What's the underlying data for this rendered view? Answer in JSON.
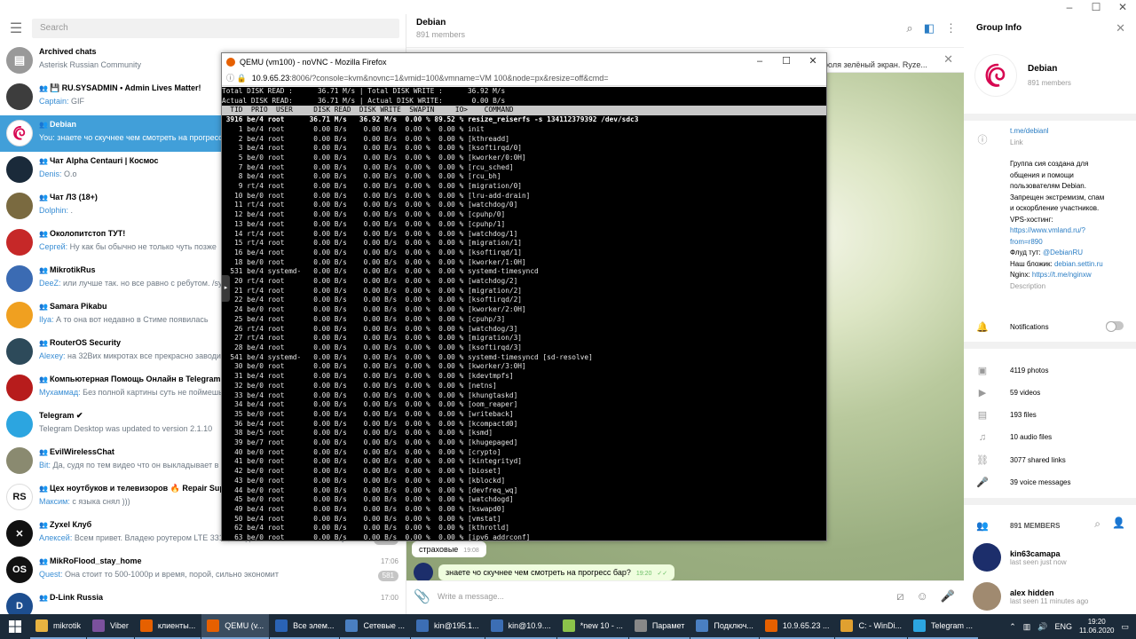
{
  "left": {
    "search_placeholder": "Search",
    "chats": [
      {
        "name": "Archived chats",
        "preview": "Asterisk Russian Community",
        "sender": "",
        "time": "",
        "badge": "",
        "color": "#999999",
        "initials": "",
        "group": false
      },
      {
        "name": "💾 RU.SYSADMIN • Admin Lives Matter!",
        "preview": "GIF",
        "sender": "Captain:",
        "time": "",
        "badge": "",
        "color": "#3d3d3d",
        "initials": "",
        "group": true
      },
      {
        "name": "Debian",
        "preview": "знаете чо скучнее чем смотреть на прогресс бар?",
        "sender": "You:",
        "time": "",
        "badge": "",
        "color": "#ffffff",
        "initials": "",
        "group": true,
        "active": true
      },
      {
        "name": "Чат Alpha Centauri | Космос",
        "preview": "О.о",
        "sender": "Denis:",
        "time": "",
        "badge": "",
        "color": "#1a2a3a",
        "initials": "",
        "group": true
      },
      {
        "name": "Чат ЛЗ (18+)",
        "preview": ".",
        "sender": "Dolphin:",
        "time": "",
        "badge": "",
        "color": "#7a6a40",
        "initials": "",
        "group": true
      },
      {
        "name": "Околопитстоп ТУТ!",
        "preview": "Ну как бы обычно не только чуть позже",
        "sender": "Сергей:",
        "time": "",
        "badge": "",
        "color": "#c62828",
        "initials": "",
        "group": true
      },
      {
        "name": "MikrotikRus",
        "preview": "или лучше так. но все равно с ребутом. /sy",
        "sender": "DeeZ:",
        "time": "",
        "badge": "",
        "color": "#3b6bb3",
        "initials": "",
        "group": true
      },
      {
        "name": "Samara Pikabu",
        "preview": "А то она вот недавно в Стиме появилась",
        "sender": "Ilya:",
        "time": "",
        "badge": "",
        "color": "#f0a020",
        "initials": "",
        "group": true
      },
      {
        "name": "RouterOS Security",
        "preview": "на 32Bих микротах все прекрасно заводи",
        "sender": "Alexey:",
        "time": "",
        "badge": "",
        "color": "#2d4a5a",
        "initials": "",
        "group": true
      },
      {
        "name": "Компьютерная Помощь Онлайн в Telegram",
        "preview": "Без полной картины суть не поймешь",
        "sender": "Мухаммад:",
        "time": "",
        "badge": "",
        "color": "#b71c1c",
        "initials": "",
        "group": true
      },
      {
        "name": "Telegram ✔",
        "preview": "Telegram Desktop was updated to version 2.1.10",
        "sender": "",
        "time": "",
        "badge": "",
        "color": "#2ca5e0",
        "initials": "",
        "group": false
      },
      {
        "name": "EvilWirelessChat",
        "preview": "Да, судя по тем видео что он выкладывает в чате",
        "sender": "Bit:",
        "time": "",
        "badge": "",
        "color": "#8a8a70",
        "initials": "",
        "group": true
      },
      {
        "name": "Цех ноутбуков и телевизоров 🔥 Repair Sup",
        "preview": "с языка снял )))",
        "sender": "Максим:",
        "time": "",
        "badge": "",
        "color": "#ffffff",
        "initials": "RS",
        "group": true
      },
      {
        "name": "Zyxel Клуб",
        "preview": "Всем привет. Владею роутером LTE 3316, Увидел на глобальном сайте упомина...",
        "sender": "Алексей:",
        "time": "",
        "badge": "1078",
        "color": "#111111",
        "initials": "✕",
        "group": true
      },
      {
        "name": "MikRoFlood_stay_home",
        "preview": "Она стоит то 500-1000р и время, порой, сильно экономит",
        "sender": "Quest:",
        "time": "17:06",
        "badge": "581",
        "color": "#111111",
        "initials": "OS",
        "group": true
      },
      {
        "name": "D-Link Russia",
        "preview": "",
        "sender": "",
        "time": "17:00",
        "badge": "",
        "color": "#1d4e8f",
        "initials": "D",
        "group": true
      }
    ]
  },
  "mid": {
    "title": "Debian",
    "subtitle": "891 members",
    "pinned": "роля зелёный экран. Ryze...",
    "messages": [
      {
        "text": "страховые",
        "time": "19:08",
        "out": false
      },
      {
        "text": "знаете чо скучнее чем смотреть на прогресс бар?",
        "time": "19:20",
        "out": true
      }
    ],
    "compose_placeholder": "Write a message..."
  },
  "right": {
    "title": "Group Info",
    "name": "Debian",
    "members_sub": "891 members",
    "link": "t.me/debianl",
    "link_label": "Link",
    "desc_lines": [
      "Группа сия создана для",
      "общения и помощи",
      "пользователям Debian.",
      "Запрещен экстремизм, спам",
      "и оскорбление участников.",
      "VPS-хостинг:"
    ],
    "vps_link": "https://www.vmland.ru/?from=r890",
    "flood_label": "Флуд тут: ",
    "flood_link": "@DebianRU",
    "blog_label": "Наш бложик: ",
    "blog_link": "debian.settin.ru",
    "nginx_label": "Nginx: ",
    "nginx_link": "https://t.me/nginxw",
    "desc_label": "Description",
    "notifications": "Notifications",
    "media": [
      {
        "icon": "▣",
        "label": "4119 photos"
      },
      {
        "icon": "▶",
        "label": "59 videos"
      },
      {
        "icon": "▤",
        "label": "193 files"
      },
      {
        "icon": "♫",
        "label": "10 audio files"
      },
      {
        "icon": "⛓",
        "label": "3077 shared links"
      },
      {
        "icon": "🎤",
        "label": "39 voice messages"
      }
    ],
    "members_header": "891 MEMBERS",
    "members": [
      {
        "name": "kin63camapa",
        "seen": "last seen just now",
        "color": "#1c2e6b"
      },
      {
        "name": "alex hidden",
        "seen": "last seen 11 minutes ago",
        "color": "#a08a70"
      }
    ]
  },
  "firefox": {
    "title": "QEMU (vm100) - noVNC - Mozilla Firefox",
    "url_host": "10.9.65.23",
    "url_rest": ":8006/?console=kvm&novnc=1&vmid=100&vmname=VM 100&node=px&resize=off&cmd=",
    "lines": [
      "Total DISK READ :      36.71 M/s | Total DISK WRITE :      36.92 M/s",
      "Actual DISK READ:      36.71 M/s | Actual DISK WRITE:       0.00 B/s",
      "  TID  PRIO  USER     DISK READ  DISK WRITE  SWAPIN     IO>    COMMAND                                          ",
      " 3916 be/4 root      36.71 M/s   36.92 M/s  0.00 % 89.52 % resize_reiserfs -s 134112379392 /dev/sdc3",
      "    1 be/4 root       0.00 B/s    0.00 B/s  0.00 %  0.00 % init",
      "    2 be/4 root       0.00 B/s    0.00 B/s  0.00 %  0.00 % [kthreadd]",
      "    3 be/4 root       0.00 B/s    0.00 B/s  0.00 %  0.00 % [ksoftirqd/0]",
      "    5 be/0 root       0.00 B/s    0.00 B/s  0.00 %  0.00 % [kworker/0:0H]",
      "    7 be/4 root       0.00 B/s    0.00 B/s  0.00 %  0.00 % [rcu_sched]",
      "    8 be/4 root       0.00 B/s    0.00 B/s  0.00 %  0.00 % [rcu_bh]",
      "    9 rt/4 root       0.00 B/s    0.00 B/s  0.00 %  0.00 % [migration/0]",
      "   10 be/0 root       0.00 B/s    0.00 B/s  0.00 %  0.00 % [lru-add-drain]",
      "   11 rt/4 root       0.00 B/s    0.00 B/s  0.00 %  0.00 % [watchdog/0]",
      "   12 be/4 root       0.00 B/s    0.00 B/s  0.00 %  0.00 % [cpuhp/0]",
      "   13 be/4 root       0.00 B/s    0.00 B/s  0.00 %  0.00 % [cpuhp/1]",
      "   14 rt/4 root       0.00 B/s    0.00 B/s  0.00 %  0.00 % [watchdog/1]",
      "   15 rt/4 root       0.00 B/s    0.00 B/s  0.00 %  0.00 % [migration/1]",
      "   16 be/4 root       0.00 B/s    0.00 B/s  0.00 %  0.00 % [ksoftirqd/1]",
      "   18 be/0 root       0.00 B/s    0.00 B/s  0.00 %  0.00 % [kworker/1:0H]",
      "  531 be/4 systemd-   0.00 B/s    0.00 B/s  0.00 %  0.00 % systemd-timesyncd",
      "   20 rt/4 root       0.00 B/s    0.00 B/s  0.00 %  0.00 % [watchdog/2]",
      "   21 rt/4 root       0.00 B/s    0.00 B/s  0.00 %  0.00 % [migration/2]",
      "   22 be/4 root       0.00 B/s    0.00 B/s  0.00 %  0.00 % [ksoftirqd/2]",
      "   24 be/0 root       0.00 B/s    0.00 B/s  0.00 %  0.00 % [kworker/2:0H]",
      "   25 be/4 root       0.00 B/s    0.00 B/s  0.00 %  0.00 % [cpuhp/3]",
      "   26 rt/4 root       0.00 B/s    0.00 B/s  0.00 %  0.00 % [watchdog/3]",
      "   27 rt/4 root       0.00 B/s    0.00 B/s  0.00 %  0.00 % [migration/3]",
      "   28 be/4 root       0.00 B/s    0.00 B/s  0.00 %  0.00 % [ksoftirqd/3]",
      "  541 be/4 systemd-   0.00 B/s    0.00 B/s  0.00 %  0.00 % systemd-timesyncd [sd-resolve]",
      "   30 be/0 root       0.00 B/s    0.00 B/s  0.00 %  0.00 % [kworker/3:0H]",
      "   31 be/4 root       0.00 B/s    0.00 B/s  0.00 %  0.00 % [kdevtmpfs]",
      "   32 be/0 root       0.00 B/s    0.00 B/s  0.00 %  0.00 % [netns]",
      "   33 be/4 root       0.00 B/s    0.00 B/s  0.00 %  0.00 % [khungtaskd]",
      "   34 be/4 root       0.00 B/s    0.00 B/s  0.00 %  0.00 % [oom_reaper]",
      "   35 be/0 root       0.00 B/s    0.00 B/s  0.00 %  0.00 % [writeback]",
      "   36 be/4 root       0.00 B/s    0.00 B/s  0.00 %  0.00 % [kcompactd0]",
      "   38 be/5 root       0.00 B/s    0.00 B/s  0.00 %  0.00 % [ksmd]",
      "   39 be/7 root       0.00 B/s    0.00 B/s  0.00 %  0.00 % [khugepaged]",
      "   40 be/0 root       0.00 B/s    0.00 B/s  0.00 %  0.00 % [crypto]",
      "   41 be/0 root       0.00 B/s    0.00 B/s  0.00 %  0.00 % [kintegrityd]",
      "   42 be/0 root       0.00 B/s    0.00 B/s  0.00 %  0.00 % [bioset]",
      "   43 be/0 root       0.00 B/s    0.00 B/s  0.00 %  0.00 % [kblockd]",
      "   44 be/0 root       0.00 B/s    0.00 B/s  0.00 %  0.00 % [devfreq_wq]",
      "   45 be/0 root       0.00 B/s    0.00 B/s  0.00 %  0.00 % [watchdogd]",
      "   49 be/4 root       0.00 B/s    0.00 B/s  0.00 %  0.00 % [kswapd0]",
      "   50 be/4 root       0.00 B/s    0.00 B/s  0.00 %  0.00 % [vmstat]",
      "   62 be/4 root       0.00 B/s    0.00 B/s  0.00 %  0.00 % [kthrotld]",
      "   63 be/0 root       0.00 B/s    0.00 B/s  0.00 %  0.00 % [ipv6_addrconf]"
    ]
  },
  "taskbar": {
    "items": [
      {
        "label": "mikrotik",
        "color": "#e8b341",
        "active": false
      },
      {
        "label": "Viber",
        "color": "#7b519d",
        "active": false
      },
      {
        "label": "клиенты...",
        "color": "#e66000",
        "active": false
      },
      {
        "label": "QEMU (v...",
        "color": "#e66000",
        "active": true
      },
      {
        "label": "Все элем...",
        "color": "#2a63b6",
        "active": false
      },
      {
        "label": "Сетевые ...",
        "color": "#4a7fc1",
        "active": false
      },
      {
        "label": "kin@195.1...",
        "color": "#3c6eb4",
        "active": false
      },
      {
        "label": "kin@10.9....",
        "color": "#3c6eb4",
        "active": false
      },
      {
        "label": "*new 10 - ...",
        "color": "#8bc34a",
        "active": false
      },
      {
        "label": "Парамет",
        "color": "#888888",
        "active": false
      },
      {
        "label": "Подключ...",
        "color": "#4a7fc1",
        "active": false
      },
      {
        "label": "10.9.65.23 ...",
        "color": "#e66000",
        "active": false
      },
      {
        "label": "C: - WinDi...",
        "color": "#e0a030",
        "active": false
      },
      {
        "label": "Telegram ...",
        "color": "#2ca5e0",
        "active": false
      }
    ],
    "lang": "ENG",
    "time": "19:20",
    "date": "11.06.2020"
  }
}
